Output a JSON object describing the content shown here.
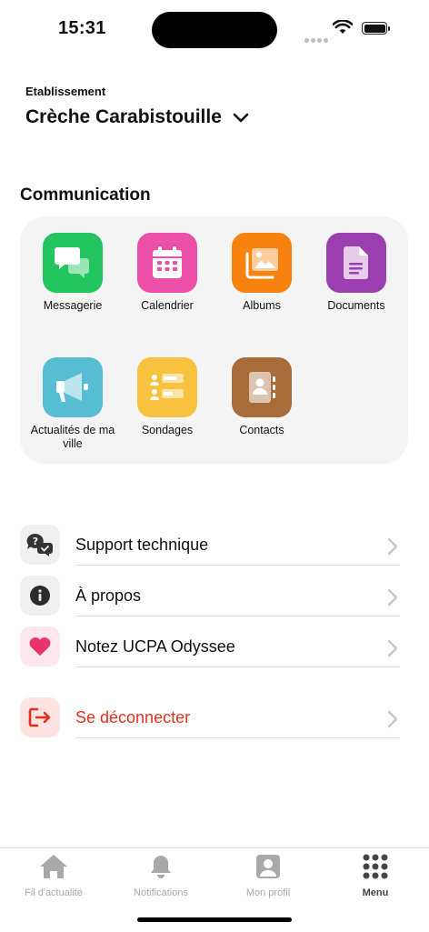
{
  "status_bar": {
    "time": "15:31"
  },
  "establishment": {
    "label": "Etablissement",
    "name": "Crèche Carabistouille"
  },
  "communication": {
    "title": "Communication",
    "tiles": [
      {
        "label": "Messagerie",
        "icon": "chat-bubbles-icon",
        "color": "#22c55e"
      },
      {
        "label": "Calendrier",
        "icon": "calendar-icon",
        "color": "#ec4fa8"
      },
      {
        "label": "Albums",
        "icon": "photo-album-icon",
        "color": "#f7830e"
      },
      {
        "label": "Documents",
        "icon": "document-icon",
        "color": "#9b3fb0"
      },
      {
        "label": "Actualités de ma ville",
        "icon": "megaphone-icon",
        "color": "#57bdd3"
      },
      {
        "label": "Sondages",
        "icon": "poll-icon",
        "color": "#f8c23f"
      },
      {
        "label": "Contacts",
        "icon": "address-book-icon",
        "color": "#a86b3a"
      }
    ]
  },
  "menu": {
    "items": [
      {
        "label": "Support technique",
        "icon": "support-chat-icon"
      },
      {
        "label": "À propos",
        "icon": "info-icon"
      },
      {
        "label": "Notez UCPA Odyssee",
        "icon": "heart-icon"
      },
      {
        "label": "Se déconnecter",
        "icon": "logout-icon",
        "color": "#e0301e"
      }
    ]
  },
  "tabbar": {
    "tabs": [
      {
        "label": "Fil d'actualité",
        "icon": "home-icon"
      },
      {
        "label": "Notifications",
        "icon": "bell-icon"
      },
      {
        "label": "Mon profil",
        "icon": "profile-icon"
      },
      {
        "label": "Menu",
        "icon": "grid-menu-icon",
        "active": true
      }
    ]
  }
}
